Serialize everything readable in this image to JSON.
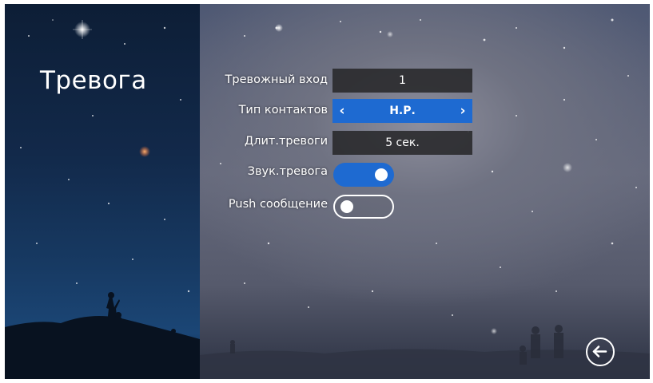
{
  "page": {
    "title": "Тревога"
  },
  "settings": {
    "alarm_input": {
      "label": "Тревожный вход",
      "value": "1"
    },
    "contact_type": {
      "label": "Тип контактов",
      "value": "Н.Р.",
      "left_icon": "chevron-left-icon",
      "right_icon": "chevron-right-icon"
    },
    "alarm_duration": {
      "label": "Длит.тревоги",
      "value": "5 сек."
    },
    "alarm_sound": {
      "label": "Звук.тревога",
      "state": "on"
    },
    "push_message": {
      "label": "Push сообщение",
      "state": "off"
    }
  },
  "controls": {
    "back_icon": "back-arrow-icon"
  },
  "colors": {
    "accent": "#1e6ad1",
    "field_bg": "#28282a",
    "text": "#ffffff"
  }
}
